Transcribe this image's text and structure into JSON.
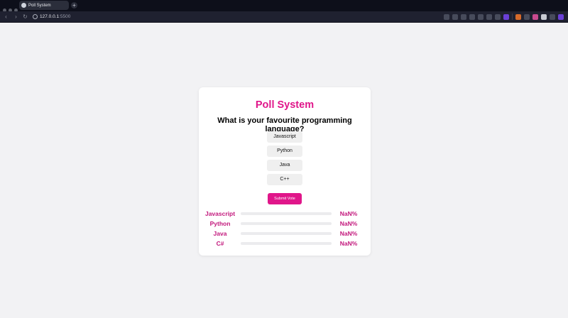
{
  "browser": {
    "tab_title": "Poll System",
    "url_host": "127.0.0.1",
    "url_port": ":5500",
    "new_tab_symbol": "+",
    "back_symbol": "‹",
    "forward_symbol": "›",
    "reload_symbol": "↻"
  },
  "poll": {
    "title": "Poll System",
    "question": "What is your favourite programming language?",
    "options": [
      "Javascript",
      "Python",
      "Java",
      "C++"
    ],
    "submit_label": "Submit Vote",
    "results": [
      {
        "label": "Javascript",
        "percent_text": "NaN%",
        "fill_fraction": 0
      },
      {
        "label": "Python",
        "percent_text": "NaN%",
        "fill_fraction": 0
      },
      {
        "label": "Java",
        "percent_text": "NaN%",
        "fill_fraction": 0
      },
      {
        "label": "C#",
        "percent_text": "NaN%",
        "fill_fraction": 0
      }
    ]
  },
  "colors": {
    "accent": "#e0168a",
    "result_text": "#c2187c",
    "page_background": "#f2f2f4",
    "browser_frame": "#0d0f1a"
  }
}
